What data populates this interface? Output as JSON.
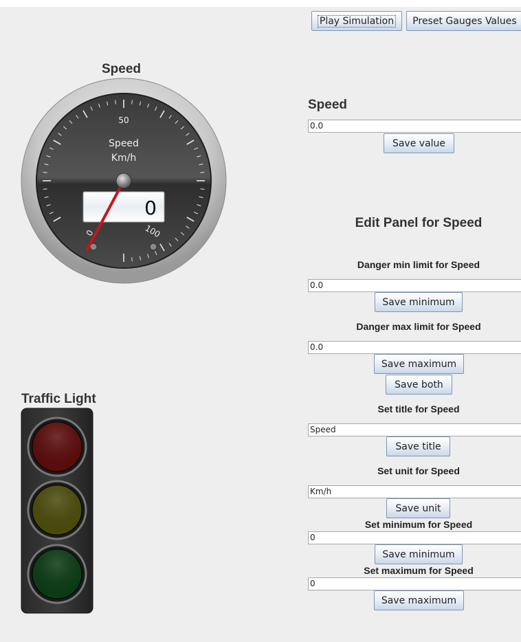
{
  "toolbar": {
    "play_label": "Play Simulation",
    "preset_label": "Preset Gauges Values"
  },
  "gauge": {
    "title": "Speed",
    "face_title": "Speed",
    "unit": "Km/h",
    "ticks": {
      "min": "0",
      "mid": "50",
      "max": "100"
    },
    "readout": "0",
    "value": 0,
    "min": 0,
    "max": 100
  },
  "traffic_light": {
    "title": "Traffic Light",
    "lamps": [
      {
        "name": "red",
        "color": "#5a0c0c"
      },
      {
        "name": "yellow",
        "color": "#4a4a0c"
      },
      {
        "name": "green",
        "color": "#0c3a14"
      }
    ]
  },
  "panel": {
    "value_heading": "Speed",
    "value_field": "0.0",
    "save_value": "Save value",
    "edit_heading": "Edit Panel for Speed",
    "danger_min_label": "Danger min limit for Speed",
    "danger_min_value": "0.0",
    "save_minimum": "Save minimum",
    "danger_max_label": "Danger max limit for Speed",
    "danger_max_value": "0.0",
    "save_maximum": "Save maximum",
    "save_both": "Save both",
    "title_label": "Set title for Speed",
    "title_value": "Speed",
    "save_title": "Save title",
    "unit_label": "Set unit for Speed",
    "unit_value": "Km/h",
    "save_unit": "Save unit",
    "min_label": "Set minimum for Speed",
    "min_value": "0",
    "save_min2": "Save minimum",
    "max_label": "Set maximum for Speed",
    "max_value": "0",
    "save_max2": "Save maximum"
  }
}
